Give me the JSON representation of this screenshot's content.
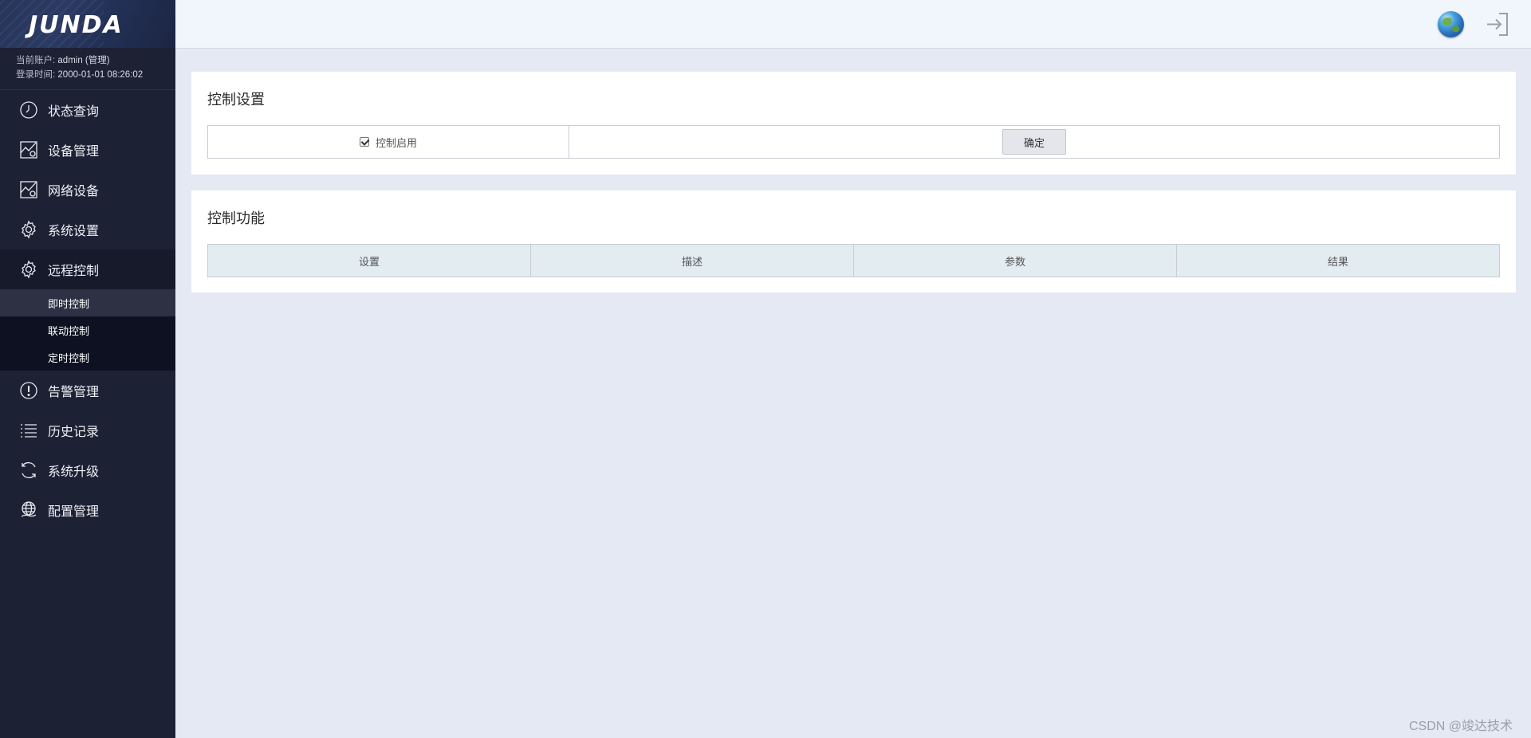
{
  "brand": {
    "logo": "JUNDA"
  },
  "account": {
    "user_label": "当前账户:",
    "user_value": "admin (管理)",
    "login_label": "登录时间:",
    "login_value": "2000-01-01 08:26:02"
  },
  "nav": {
    "items": [
      {
        "label": "状态查询",
        "icon": "clock-icon"
      },
      {
        "label": "设备管理",
        "icon": "device-chart-icon"
      },
      {
        "label": "网络设备",
        "icon": "network-chart-icon"
      },
      {
        "label": "系统设置",
        "icon": "gear-icon"
      },
      {
        "label": "远程控制",
        "icon": "gear-icon"
      },
      {
        "label": "告警管理",
        "icon": "alert-icon"
      },
      {
        "label": "历史记录",
        "icon": "list-icon"
      },
      {
        "label": "系统升级",
        "icon": "refresh-icon"
      },
      {
        "label": "配置管理",
        "icon": "globe-hand-icon"
      }
    ],
    "submenu": [
      "即时控制",
      "联动控制",
      "定时控制"
    ],
    "active_submenu": "即时控制"
  },
  "header": {
    "icons": [
      "language-globe-icon",
      "logout-icon"
    ]
  },
  "control_settings": {
    "title": "控制设置",
    "enable_label": "控制启用",
    "enable_checked": true,
    "confirm_label": "确定"
  },
  "control_functions": {
    "title": "控制功能",
    "columns": [
      "设置",
      "描述",
      "参数",
      "结果"
    ]
  },
  "watermark": "CSDN @竣达技术",
  "colors": {
    "sidebar_bg": "#1c2134",
    "submenu_bg": "#0e1122",
    "submenu_active": "#2c3144",
    "content_bg": "#e4e9f4",
    "table_header_bg": "#e2ecf1"
  }
}
